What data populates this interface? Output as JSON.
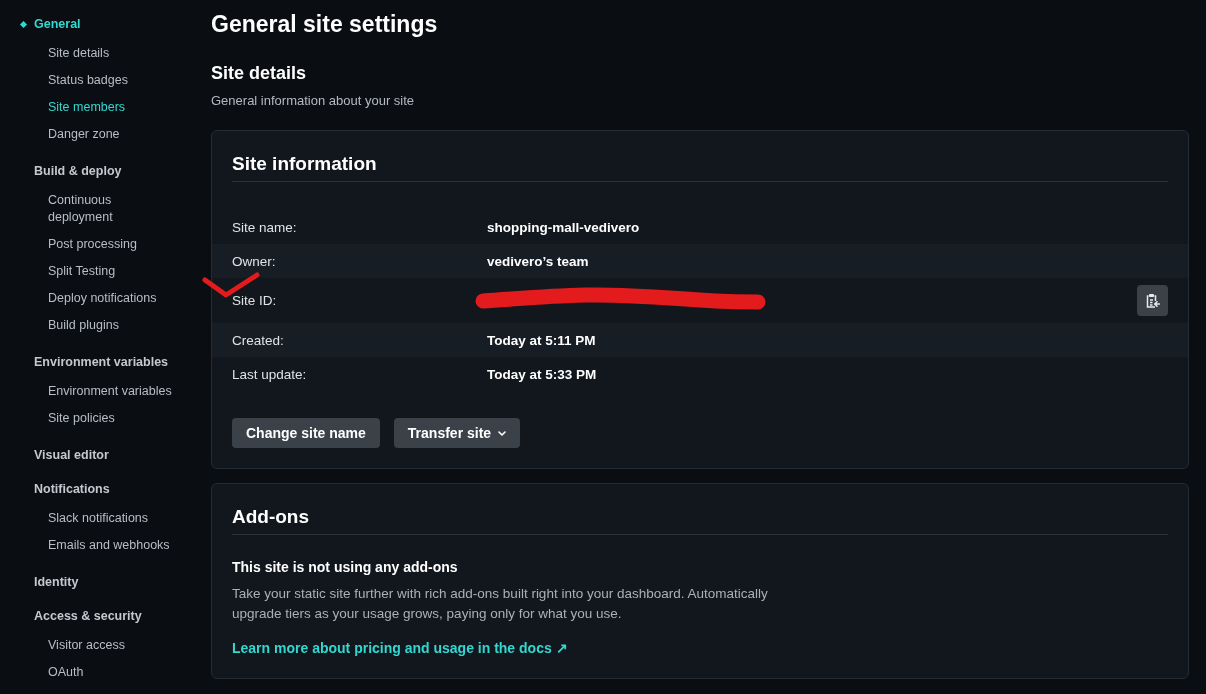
{
  "sidebar": {
    "groups": [
      {
        "label": "General",
        "selected": true,
        "items": [
          {
            "label": "Site details",
            "selected": false
          },
          {
            "label": "Status badges",
            "selected": false
          },
          {
            "label": "Site members",
            "selected": true
          },
          {
            "label": "Danger zone",
            "selected": false
          }
        ]
      },
      {
        "label": "Build & deploy",
        "selected": false,
        "items": [
          {
            "label": "Continuous deployment",
            "selected": false
          },
          {
            "label": "Post processing",
            "selected": false
          },
          {
            "label": "Split Testing",
            "selected": false
          },
          {
            "label": "Deploy notifications",
            "selected": false
          },
          {
            "label": "Build plugins",
            "selected": false
          }
        ]
      },
      {
        "label": "Environment variables",
        "selected": false,
        "items": [
          {
            "label": "Environment variables",
            "selected": false
          },
          {
            "label": "Site policies",
            "selected": false
          }
        ]
      },
      {
        "label": "Visual editor",
        "selected": false
      },
      {
        "label": "Notifications",
        "selected": false,
        "items": [
          {
            "label": "Slack notifications",
            "selected": false
          },
          {
            "label": "Emails and webhooks",
            "selected": false
          }
        ]
      },
      {
        "label": "Identity",
        "selected": false
      },
      {
        "label": "Access & security",
        "selected": false,
        "items": [
          {
            "label": "Visitor access",
            "selected": false
          },
          {
            "label": "OAuth",
            "selected": false
          }
        ]
      }
    ]
  },
  "page": {
    "title": "General site settings"
  },
  "section": {
    "title": "Site details",
    "subtitle": "General information about your site"
  },
  "site_information": {
    "title": "Site information",
    "rows": [
      {
        "label": "Site name:",
        "value": "shopping-mall-vedivero"
      },
      {
        "label": "Owner:",
        "value": "vedivero’s team"
      },
      {
        "label": "Site ID:",
        "redacted": true,
        "marked": true,
        "copy_button": true
      },
      {
        "label": "Created:",
        "value": "Today at 5:11 PM"
      },
      {
        "label": "Last update:",
        "value": "Today at 5:33 PM"
      }
    ],
    "buttons": [
      {
        "label": "Change site name",
        "kind": "plain"
      },
      {
        "label": "Transfer site",
        "kind": "dropdown"
      }
    ]
  },
  "add_ons": {
    "title": "Add-ons",
    "heading": "This site is not using any add-ons",
    "text": "Take your static site further with rich add-ons built right into your dashboard. Automatically upgrade tiers as your usage grows, paying only for what you use.",
    "link": "Learn more about pricing and usage in the docs ↗"
  }
}
